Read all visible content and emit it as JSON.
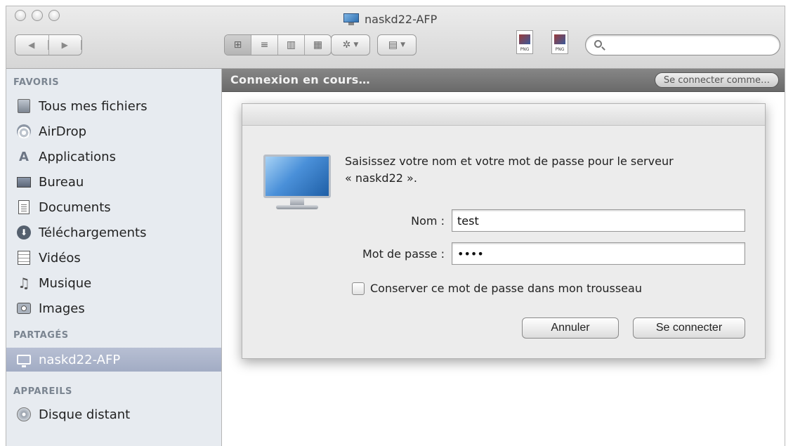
{
  "window": {
    "title": "naskd22-AFP"
  },
  "toolbar": {
    "back_icon": "chevron-left-icon",
    "forward_icon": "chevron-right-icon",
    "view_modes": [
      "icon-view-icon",
      "list-view-icon",
      "column-view-icon",
      "coverflow-view-icon"
    ],
    "action_icon": "gear-icon",
    "arrange_icon": "grid-icon",
    "file_icons": [
      {
        "label": "PNG"
      },
      {
        "label": "PNG"
      }
    ],
    "search": {
      "placeholder": "",
      "value": ""
    }
  },
  "sidebar": {
    "favorites_header": "FAVORIS",
    "favorites": [
      {
        "label": "Tous mes fichiers",
        "icon": "all-files-icon"
      },
      {
        "label": "AirDrop",
        "icon": "airdrop-icon"
      },
      {
        "label": "Applications",
        "icon": "applications-icon"
      },
      {
        "label": "Bureau",
        "icon": "desktop-icon"
      },
      {
        "label": "Documents",
        "icon": "documents-icon"
      },
      {
        "label": "Téléchargements",
        "icon": "downloads-icon"
      },
      {
        "label": "Vidéos",
        "icon": "movies-icon"
      },
      {
        "label": "Musique",
        "icon": "music-icon"
      },
      {
        "label": "Images",
        "icon": "pictures-icon"
      }
    ],
    "shared_header": "PARTAGÉS",
    "shared": [
      {
        "label": "naskd22-AFP",
        "icon": "monitor-icon",
        "selected": true
      }
    ],
    "devices_header": "APPAREILS",
    "devices": [
      {
        "label": "Disque distant",
        "icon": "disk-icon"
      }
    ]
  },
  "status": {
    "text": "Connexion en cours…",
    "connect_as_label": "Se connecter comme…"
  },
  "dialog": {
    "message_line1": "Saisissez votre nom et votre mot de passe pour le serveur",
    "message_line2": "« naskd22 ».",
    "name_label": "Nom :",
    "name_value": "test",
    "password_label": "Mot de passe :",
    "password_value": "••••",
    "remember_label": "Conserver ce mot de passe dans mon trousseau",
    "remember_checked": false,
    "cancel_label": "Annuler",
    "connect_label": "Se connecter"
  },
  "colors": {
    "sidebar_bg": "#e7ebf0",
    "selected_bg": "#a9b2c8",
    "status_bar_bg": "#777777",
    "dialog_bg": "#ececec"
  }
}
